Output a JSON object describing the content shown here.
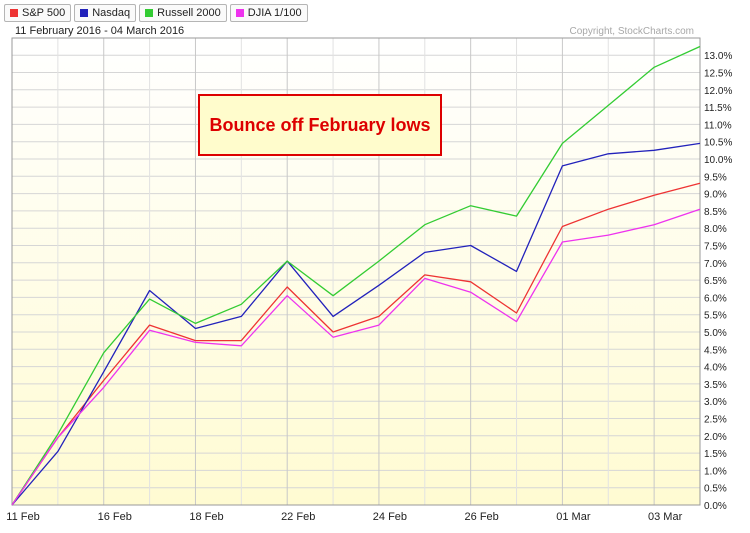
{
  "legend": [
    {
      "label": "S&P 500",
      "color": "#ee3333"
    },
    {
      "label": "Nasdaq",
      "color": "#2222bb"
    },
    {
      "label": "Russell 2000",
      "color": "#33cc33"
    },
    {
      "label": "DJIA 1/100",
      "color": "#ee33ee"
    }
  ],
  "header": {
    "date_range": "11 February 2016 - 04 March 2016",
    "copyright": "Copyright, StockCharts.com"
  },
  "annotation": "Bounce off February lows",
  "colors": {
    "plot_bg_top": "#ffffff",
    "plot_bg_bottom": "#fffbd2",
    "annotation_border": "#dd0000",
    "annotation_bg": "#fffccc",
    "grid": "#d6d6d6"
  },
  "chart_data": {
    "type": "line",
    "x": [
      "11 Feb",
      "12 Feb",
      "16 Feb",
      "17 Feb",
      "18 Feb",
      "19 Feb",
      "22 Feb",
      "23 Feb",
      "24 Feb",
      "25 Feb",
      "26 Feb",
      "29 Feb",
      "01 Mar",
      "02 Mar",
      "03 Mar",
      "04 Mar"
    ],
    "x_tick_labels": [
      "11 Feb",
      "16 Feb",
      "18 Feb",
      "22 Feb",
      "24 Feb",
      "26 Feb",
      "01 Mar",
      "03 Mar"
    ],
    "ylim": [
      0,
      13.3
    ],
    "y_ticks": [
      "0.0%",
      "0.5%",
      "1.0%",
      "1.5%",
      "2.0%",
      "2.5%",
      "3.0%",
      "3.5%",
      "4.0%",
      "4.5%",
      "5.0%",
      "5.5%",
      "6.0%",
      "6.5%",
      "7.0%",
      "7.5%",
      "8.0%",
      "8.5%",
      "9.0%",
      "9.5%",
      "10.0%",
      "10.5%",
      "11.0%",
      "11.5%",
      "12.0%",
      "12.5%",
      "13.0%"
    ],
    "grid": true,
    "series": [
      {
        "name": "S&P 500",
        "color": "#ee3333",
        "values": [
          0,
          1.95,
          3.6,
          5.2,
          4.75,
          4.75,
          6.3,
          5.0,
          5.45,
          6.65,
          6.45,
          5.55,
          8.05,
          8.55,
          8.95,
          9.3
        ]
      },
      {
        "name": "Nasdaq",
        "color": "#2222bb",
        "values": [
          0,
          1.55,
          3.85,
          6.2,
          5.1,
          5.45,
          7.05,
          5.45,
          6.35,
          7.3,
          7.5,
          6.75,
          9.8,
          10.15,
          10.25,
          10.45
        ]
      },
      {
        "name": "Russell 2000",
        "color": "#33cc33",
        "values": [
          0,
          2.05,
          4.4,
          5.95,
          5.25,
          5.8,
          7.05,
          6.05,
          7.05,
          8.1,
          8.65,
          8.35,
          10.45,
          11.55,
          12.65,
          13.25
        ]
      },
      {
        "name": "DJIA 1/100",
        "color": "#ee33ee",
        "values": [
          0,
          1.95,
          3.4,
          5.05,
          4.7,
          4.6,
          6.05,
          4.85,
          5.2,
          6.55,
          6.15,
          5.3,
          7.6,
          7.8,
          8.1,
          8.55
        ]
      }
    ]
  }
}
